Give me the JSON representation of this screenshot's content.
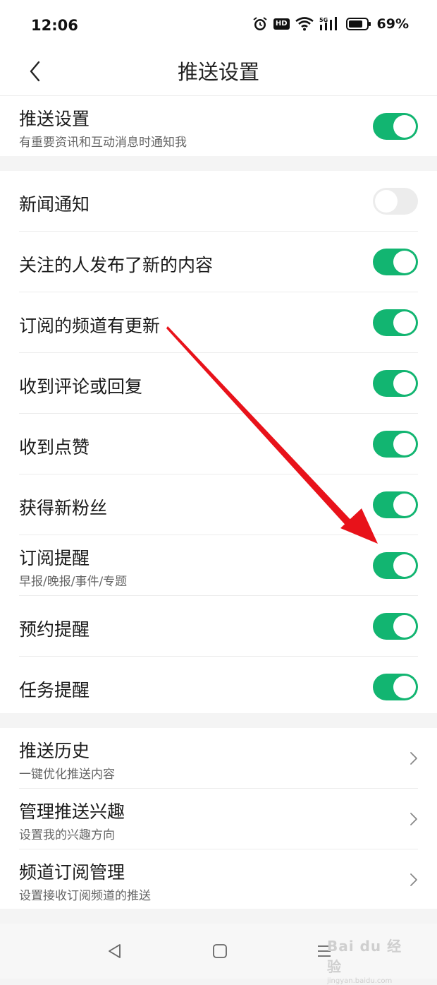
{
  "status_bar": {
    "time": "12:06",
    "hd": "HD",
    "network": "5G",
    "battery": "69%"
  },
  "header": {
    "title": "推送设置"
  },
  "master": {
    "label": "推送设置",
    "sub": "有重要资讯和互动消息时通知我",
    "on": true
  },
  "toggles": [
    {
      "label": "新闻通知",
      "on": false
    },
    {
      "label": "关注的人发布了新的内容",
      "on": true
    },
    {
      "label": "订阅的频道有更新",
      "on": true
    },
    {
      "label": "收到评论或回复",
      "on": true
    },
    {
      "label": "收到点赞",
      "on": true
    },
    {
      "label": "获得新粉丝",
      "on": true
    },
    {
      "label": "订阅提醒",
      "sub": "早报/晚报/事件/专题",
      "on": true
    },
    {
      "label": "预约提醒",
      "on": true
    },
    {
      "label": "任务提醒",
      "on": true
    }
  ],
  "links": [
    {
      "label": "推送历史",
      "sub": "一键优化推送内容"
    },
    {
      "label": "管理推送兴趣",
      "sub": "设置我的兴趣方向"
    },
    {
      "label": "频道订阅管理",
      "sub": "设置接收订阅频道的推送"
    }
  ],
  "watermark": {
    "logo": "Bai du 经验",
    "url": "jingyan.baidu.com"
  },
  "colors": {
    "accent": "#12b571",
    "annotation_arrow": "#e8121a"
  }
}
